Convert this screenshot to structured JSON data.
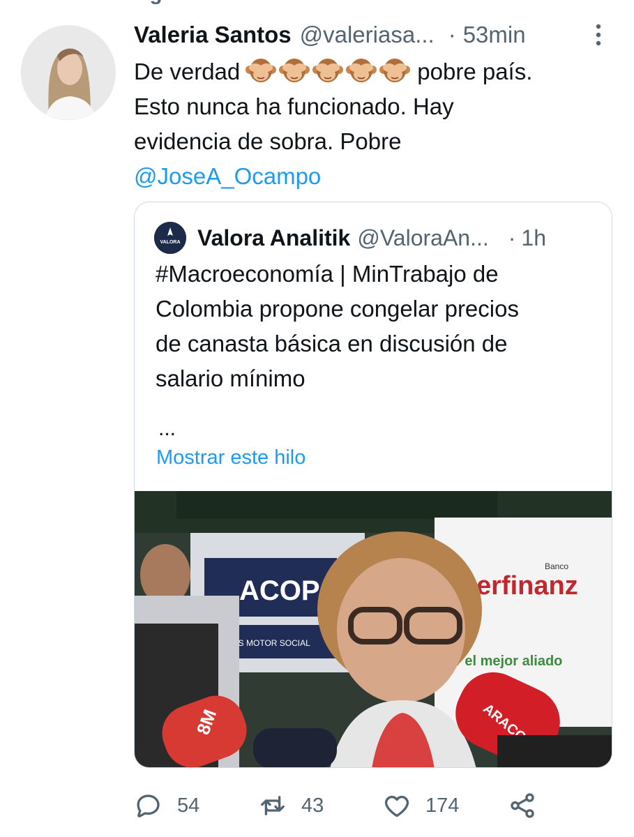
{
  "tweet": {
    "display_name": "Valeria Santos",
    "handle": "@valeriasa...",
    "separator": "·",
    "time": "53min",
    "text_line1_a": "De verdad",
    "text_line1_b": "pobre país.",
    "text_line2": "Esto nunca ha funcionado. Hay",
    "text_line3": "evidencia de sobra. Pobre",
    "mention": "@JoseA_Ocampo",
    "emoji_icon": "see-no-evil-monkey",
    "emoji_count": 5
  },
  "quote": {
    "avatar_text": "VALORA",
    "display_name": "Valora Analitik",
    "handle": "@ValoraAn...",
    "separator": "·",
    "time": "1h",
    "lines": [
      "#Macroeconomía | MinTrabajo de",
      "Colombia propone congelar precios",
      "de canasta básica en discusión de",
      "salario mínimo"
    ],
    "ellipsis": "...",
    "show_thread": "Mostrar este hilo",
    "media": {
      "sign_left": "ACOP",
      "sign_left_sub": "SOMOS MOTOR SOCIAL",
      "sign_right": "erfinanz",
      "sign_right_banco": "Banco",
      "sign_right_slogan": "r el mejor aliado",
      "mic_left": "8M",
      "mic_right": "ARACOL"
    }
  },
  "actions": {
    "reply_count": "54",
    "retweet_count": "43",
    "like_count": "174"
  },
  "colors": {
    "accent": "#1d9bf0",
    "secondary_text": "#536471",
    "border": "#cfd9de"
  }
}
